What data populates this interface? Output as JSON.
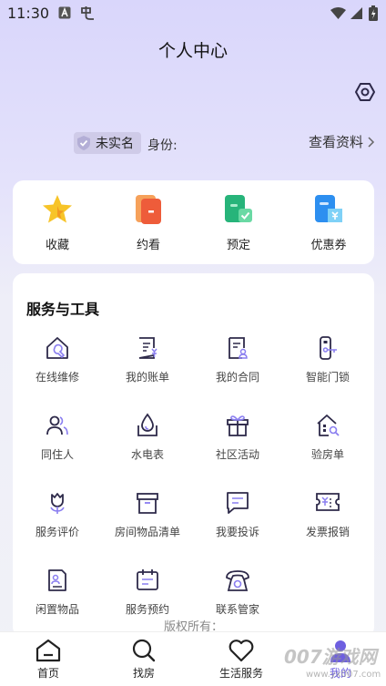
{
  "status_bar": {
    "time": "11:30"
  },
  "header": {
    "title": "个人中心"
  },
  "profile": {
    "verify_status": "未实名",
    "identity_label": "身份:",
    "view_profile": "查看资料"
  },
  "quick_actions": [
    {
      "label": "收藏",
      "icon": "star-icon"
    },
    {
      "label": "约看",
      "icon": "appointment-icon"
    },
    {
      "label": "预定",
      "icon": "reservation-icon"
    },
    {
      "label": "优惠券",
      "icon": "coupon-icon"
    }
  ],
  "services": {
    "title": "服务与工具",
    "items": [
      {
        "label": "在线维修",
        "icon": "repair-icon"
      },
      {
        "label": "我的账单",
        "icon": "bill-icon"
      },
      {
        "label": "我的合同",
        "icon": "contract-icon"
      },
      {
        "label": "智能门锁",
        "icon": "smart-lock-icon"
      },
      {
        "label": "同住人",
        "icon": "roommates-icon"
      },
      {
        "label": "水电表",
        "icon": "water-electric-meter-icon"
      },
      {
        "label": "社区活动",
        "icon": "gift-icon"
      },
      {
        "label": "验房单",
        "icon": "house-inspection-icon"
      },
      {
        "label": "服务评价",
        "icon": "flower-review-icon"
      },
      {
        "label": "房间物品清单",
        "icon": "box-icon"
      },
      {
        "label": "我要投诉",
        "icon": "complaint-icon"
      },
      {
        "label": "发票报销",
        "icon": "invoice-icon"
      },
      {
        "label": "闲置物品",
        "icon": "idle-items-icon"
      },
      {
        "label": "服务预约",
        "icon": "calendar-icon"
      },
      {
        "label": "联系管家",
        "icon": "telephone-icon"
      }
    ]
  },
  "footer": {
    "copyright": "版权所有："
  },
  "tab_bar": [
    {
      "label": "首页",
      "icon": "home-icon"
    },
    {
      "label": "找房",
      "icon": "search-icon"
    },
    {
      "label": "生活服务",
      "icon": "heart-icon"
    },
    {
      "label": "我的",
      "icon": "user-icon"
    }
  ],
  "watermark": {
    "text": "007游戏网",
    "url": "www.yx007.com"
  },
  "colors": {
    "accent": "#6e5fe0",
    "icon_stroke": "#2e2a4a",
    "icon_accent": "#8a7ef0"
  }
}
